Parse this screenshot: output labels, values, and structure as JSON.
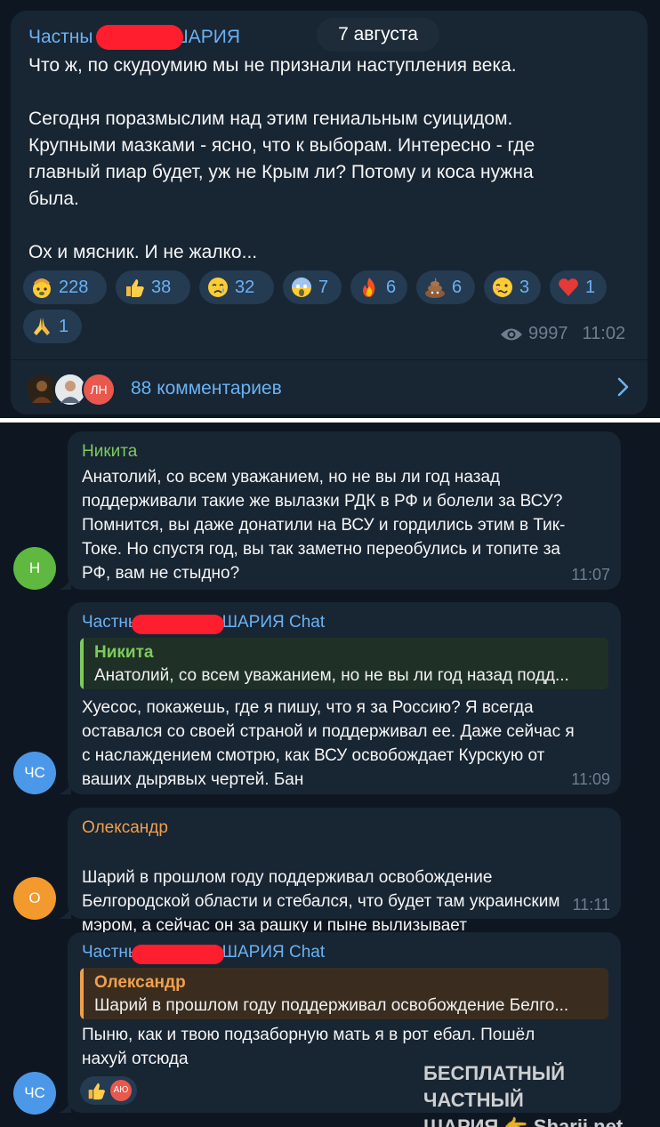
{
  "post": {
    "author_prefix": "Частны",
    "author_suffix": "ШАРИЯ",
    "date": "7 августа",
    "paragraphs": [
      "Что ж, по скудоумию мы не признали наступления века.",
      "Сегодня поразмыслим над этим гениальным суицидом.\nКрупными мазками - ясно, что к выборам. Интересно - где\nглавный пиар будет, уж не Крым ли? Потому и коса нужна\nбыла.",
      "Ох и мясник. И не жалко..."
    ],
    "reactions": [
      {
        "icon": "exploding-head-icon",
        "count": "228"
      },
      {
        "icon": "thumbs-up-icon",
        "count": "38"
      },
      {
        "icon": "crying-face-icon",
        "count": "32"
      },
      {
        "icon": "screaming-face-icon",
        "count": "7"
      },
      {
        "icon": "fire-icon",
        "count": "6"
      },
      {
        "icon": "poop-icon",
        "count": "6"
      },
      {
        "icon": "woozy-face-icon",
        "count": "3"
      },
      {
        "icon": "red-heart-icon",
        "count": "1"
      },
      {
        "icon": "folded-hands-icon",
        "count": "1"
      }
    ],
    "views": "9997",
    "time": "11:02",
    "commenter_initials": "ЛН",
    "comments_label": "88 комментариев"
  },
  "messages": [
    {
      "sender": "Никита",
      "sender_color": "#7ccb5c",
      "avatar_initials": "Н",
      "avatar_color": "#5fb83f",
      "text": "Анатолий, со всем уважанием, но не вы ли год назад\nподдерживали такие же вылазки РДК в РФ и болели за ВСУ?\nПомнится, вы даже донатили на ВСУ и гордились этим в Тик-\nТоке. Но спустя год, вы так заметно переобулись и топите за\nРФ, вам не стыдно?",
      "time": "11:07"
    },
    {
      "sender_prefix": "Частны",
      "sender_suffix": "ШАРИЯ Chat",
      "sender_color": "#6ab2f2",
      "avatar_initials": "ЧС",
      "avatar_color": "#4c98e8",
      "reply_name": "Никита",
      "reply_text": "Анатолий, со всем уважанием, но не вы ли год назад подд...",
      "text": "Хуесос, покажешь, где я пишу, что я за Россию? Я всегда\nоставался со своей страной и поддерживал ее. Даже сейчас я\nс наслаждением смотрю, как ВСУ освобождает Курскую от\nваших дырявых чертей. Бан",
      "time": "11:09"
    },
    {
      "sender": "Олександр",
      "sender_color": "#f0a04c",
      "avatar_initials": "О",
      "avatar_color": "#f29a2e",
      "text": "Шарий в прошлом году поддерживал освобождение\nБелгородской области и стебался, что будет там украинским\nмэром, а сейчас он за рашку и пыне вылизывает",
      "time": "11:11"
    },
    {
      "sender_prefix": "Частны",
      "sender_suffix": "ШАРИЯ Chat",
      "sender_color": "#6ab2f2",
      "avatar_initials": "ЧС",
      "avatar_color": "#4c98e8",
      "reply_name": "Олександр",
      "reply_text": "Шарий в прошлом году поддерживал освобождение Белго...",
      "text": "Пыню, как и твою подзаборную мать я в рот ебал. Пошёл\nнахуй отсюда",
      "reaction_initials": "АЮ"
    }
  ],
  "watermark": {
    "line1": "БЕСПЛАТНЫЙ ЧАСТНЫЙ",
    "line2": "ШАРИЯ 👉 Sharij.net"
  }
}
